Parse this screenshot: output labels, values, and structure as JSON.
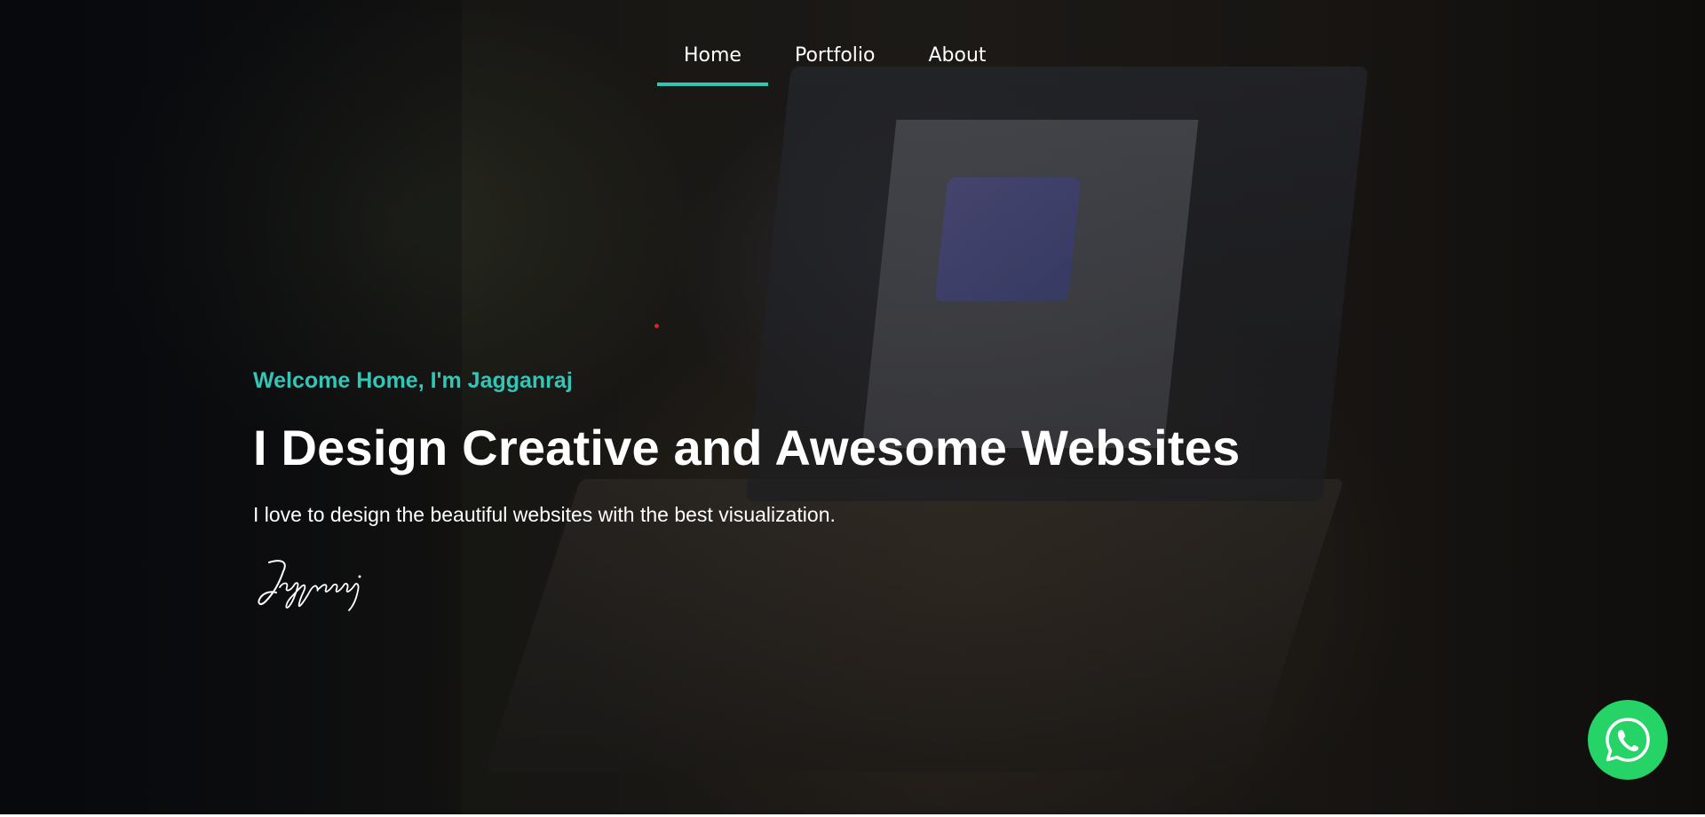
{
  "nav": {
    "items": [
      {
        "label": "Home",
        "active": true
      },
      {
        "label": "Portfolio",
        "active": false
      },
      {
        "label": "About",
        "active": false
      }
    ],
    "accent_color": "#2fc6b6"
  },
  "hero": {
    "welcome": "Welcome Home, I'm Jagganraj",
    "headline": "I Design Creative and Awesome Websites",
    "tagline": "I love to design the beautiful websites with the best visualization.",
    "signature": "Jagganraj",
    "accent_color": "#33c5b5"
  },
  "floating": {
    "whatsapp_icon": "whatsapp-icon",
    "whatsapp_color": "#25d366"
  }
}
